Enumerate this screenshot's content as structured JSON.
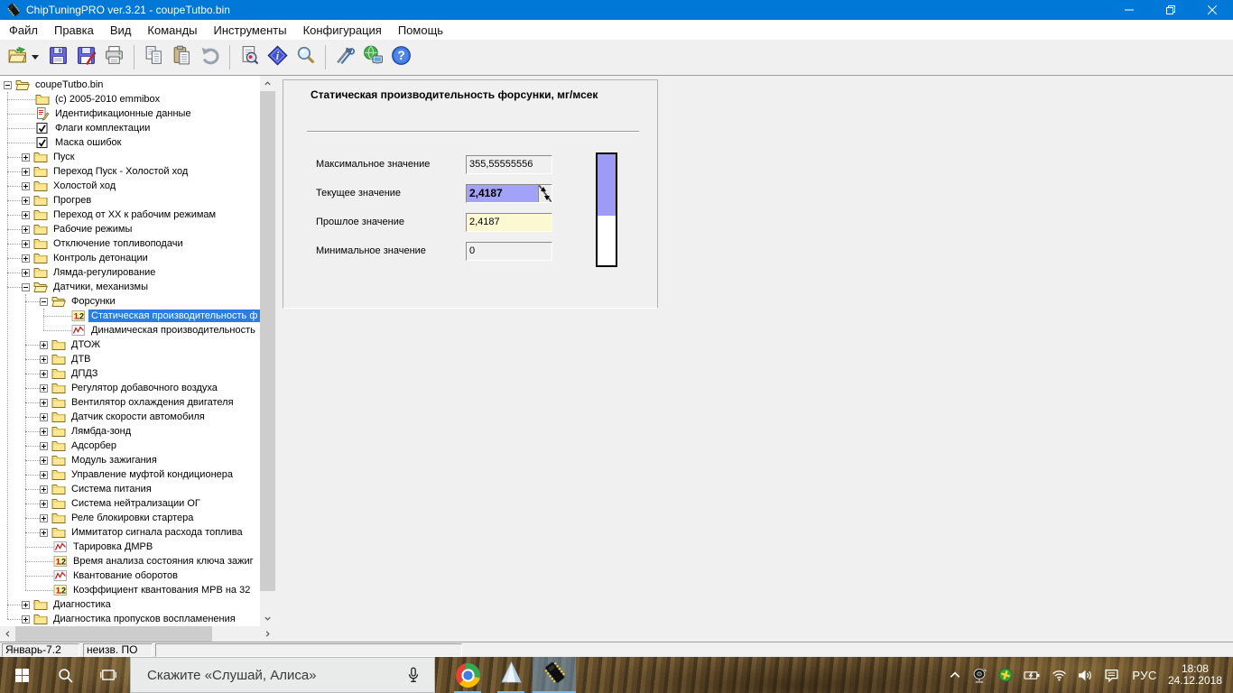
{
  "window": {
    "title": "ChipTuningPRO ver.3.21 - coupeTutbo.bin"
  },
  "menu": {
    "items": [
      "Файл",
      "Правка",
      "Вид",
      "Команды",
      "Инструменты",
      "Конфигурация",
      "Помощь"
    ]
  },
  "toolbar": {
    "buttons": [
      "open",
      "save",
      "save-as",
      "print",
      "sep",
      "copy",
      "paste",
      "undo",
      "sep",
      "preview",
      "info",
      "search",
      "sep",
      "tools",
      "network",
      "help"
    ]
  },
  "tree": {
    "items": [
      {
        "label": "coupeTutbo.bin",
        "depth": 0,
        "icon": "folder-open",
        "expand": "minus"
      },
      {
        "label": "(c) 2005-2010 emmibox",
        "depth": 1,
        "icon": "folder",
        "expand": "none"
      },
      {
        "label": "Идентификационные данные",
        "depth": 1,
        "icon": "doc-edit",
        "expand": "none"
      },
      {
        "label": "Флаги комплектации",
        "depth": 1,
        "icon": "checkbox",
        "expand": "none"
      },
      {
        "label": "Маска ошибок",
        "depth": 1,
        "icon": "checkbox",
        "expand": "none"
      },
      {
        "label": "Пуск",
        "depth": 1,
        "icon": "folder",
        "expand": "plus"
      },
      {
        "label": "Переход Пуск - Холостой ход",
        "depth": 1,
        "icon": "folder",
        "expand": "plus"
      },
      {
        "label": "Холостой ход",
        "depth": 1,
        "icon": "folder",
        "expand": "plus"
      },
      {
        "label": "Прогрев",
        "depth": 1,
        "icon": "folder",
        "expand": "plus"
      },
      {
        "label": "Переход от ХХ к рабочим режимам",
        "depth": 1,
        "icon": "folder",
        "expand": "plus"
      },
      {
        "label": "Рабочие режимы",
        "depth": 1,
        "icon": "folder",
        "expand": "plus"
      },
      {
        "label": "Отключение топливоподачи",
        "depth": 1,
        "icon": "folder",
        "expand": "plus"
      },
      {
        "label": "Контроль детонации",
        "depth": 1,
        "icon": "folder",
        "expand": "plus"
      },
      {
        "label": "Лямда-регулирование",
        "depth": 1,
        "icon": "folder",
        "expand": "plus"
      },
      {
        "label": "Датчики, механизмы",
        "depth": 1,
        "icon": "folder-open",
        "expand": "minus"
      },
      {
        "label": "Форсунки",
        "depth": 2,
        "icon": "folder-open",
        "expand": "minus"
      },
      {
        "label": "Статическая производительность ф",
        "depth": 3,
        "icon": "num12",
        "expand": "none",
        "selected": true
      },
      {
        "label": "Динамическая производительность",
        "depth": 3,
        "icon": "graph",
        "expand": "none"
      },
      {
        "label": "ДТОЖ",
        "depth": 2,
        "icon": "folder",
        "expand": "plus"
      },
      {
        "label": "ДТВ",
        "depth": 2,
        "icon": "folder",
        "expand": "plus"
      },
      {
        "label": "ДПДЗ",
        "depth": 2,
        "icon": "folder",
        "expand": "plus"
      },
      {
        "label": "Регулятор добавочного воздуха",
        "depth": 2,
        "icon": "folder",
        "expand": "plus"
      },
      {
        "label": "Вентилятор охлаждения двигателя",
        "depth": 2,
        "icon": "folder",
        "expand": "plus"
      },
      {
        "label": "Датчик скорости автомобиля",
        "depth": 2,
        "icon": "folder",
        "expand": "plus"
      },
      {
        "label": "Лямбда-зонд",
        "depth": 2,
        "icon": "folder",
        "expand": "plus"
      },
      {
        "label": "Адсорбер",
        "depth": 2,
        "icon": "folder",
        "expand": "plus"
      },
      {
        "label": "Модуль зажигания",
        "depth": 2,
        "icon": "folder",
        "expand": "plus"
      },
      {
        "label": "Управление муфтой кондиционера",
        "depth": 2,
        "icon": "folder",
        "expand": "plus"
      },
      {
        "label": "Система питания",
        "depth": 2,
        "icon": "folder",
        "expand": "plus"
      },
      {
        "label": "Система нейтрализации ОГ",
        "depth": 2,
        "icon": "folder",
        "expand": "plus"
      },
      {
        "label": "Реле блокировки стартера",
        "depth": 2,
        "icon": "folder",
        "expand": "plus"
      },
      {
        "label": "Иммитатор сигнала расхода топлива",
        "depth": 2,
        "icon": "folder",
        "expand": "plus"
      },
      {
        "label": "Тарировка ДМРВ",
        "depth": 2,
        "icon": "graph",
        "expand": "none"
      },
      {
        "label": "Время анализа состояния ключа зажиг",
        "depth": 2,
        "icon": "num12",
        "expand": "none"
      },
      {
        "label": "Квантование оборотов",
        "depth": 2,
        "icon": "graph",
        "expand": "none"
      },
      {
        "label": "Коэффициент квантования МРВ на 32",
        "depth": 2,
        "icon": "num12",
        "expand": "none"
      },
      {
        "label": "Диагностика",
        "depth": 1,
        "icon": "folder",
        "expand": "plus"
      },
      {
        "label": "Диагностика пропусков воспламенения",
        "depth": 1,
        "icon": "folder",
        "expand": "plus"
      }
    ]
  },
  "panel": {
    "title": "Статическая производительность форсунки, мг/мсек",
    "fields": [
      {
        "name": "max-value",
        "label": "Максимальное значение",
        "value": "355,55555556",
        "kind": "readonly"
      },
      {
        "name": "current-value",
        "label": "Текущее значение",
        "value": "2,4187",
        "kind": "spinner"
      },
      {
        "name": "previous-value",
        "label": "Прошлое значение",
        "value": "2,4187",
        "kind": "previous"
      },
      {
        "name": "min-value",
        "label": "Минимальное значение",
        "value": "0",
        "kind": "readonly"
      }
    ],
    "gauge": {
      "fill_percent": 55
    }
  },
  "statusbar": {
    "sections": [
      "Январь-7.2",
      "неизв. ПО",
      ""
    ]
  },
  "taskbar": {
    "search_text": "Скажите «Слушай, Алиса»",
    "apps": [
      {
        "name": "chrome",
        "active": false
      },
      {
        "name": "prism",
        "active": false
      },
      {
        "name": "chiptuning",
        "active": true
      }
    ],
    "tray_icons": [
      "chevron-up",
      "satellite",
      "antivirus",
      "battery",
      "wifi",
      "volume",
      "action-center"
    ],
    "tray": {
      "language": "РУС",
      "time": "18:08",
      "date": "24.12.2018"
    }
  },
  "colors": {
    "titlebar_blue": "#0078d7",
    "tree_selection": "#2a7de2",
    "current_field_bg": "#a2a2f8",
    "previous_field_bg": "#fbf8d2",
    "gauge_fill": "#9c9cf6",
    "taskbar_indicator": "#76b9ed"
  }
}
